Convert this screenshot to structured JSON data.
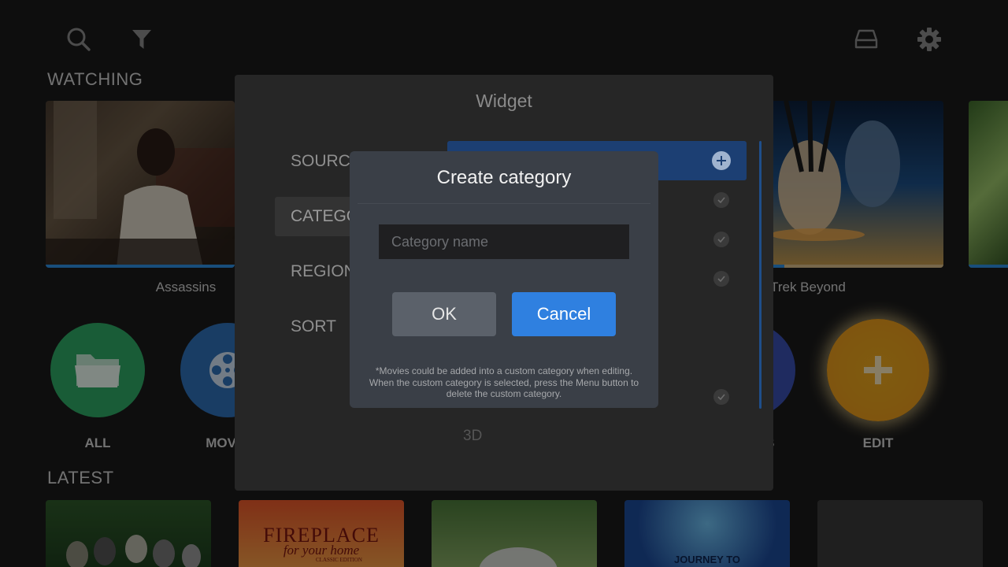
{
  "toolbar": {
    "left_icons": [
      "search-icon",
      "filter-icon"
    ],
    "right_icons": [
      "storage-icon",
      "gear-icon"
    ]
  },
  "watching": {
    "title": "WATCHING",
    "items": [
      {
        "title": "Assassins",
        "progress": 1.0
      },
      {
        "title": "Star Trek Beyond",
        "visible_title": "r Trek Beyond",
        "progress": 0.16
      }
    ]
  },
  "categories": {
    "items": [
      {
        "label": "ALL",
        "icon": "folder-icon",
        "color": "#2fa865"
      },
      {
        "label": "MOV",
        "icon": "film-reel-icon",
        "color": "#2f6fb6"
      },
      {
        "label": "S",
        "icon": "",
        "color": "#3a4fb0"
      },
      {
        "label": "EDIT",
        "icon": "plus-icon",
        "color": "#e7a521"
      }
    ]
  },
  "latest": {
    "title": "LATEST",
    "tiles": [
      {
        "text": ""
      },
      {
        "text": "FIREPLACE",
        "sub": "for your home",
        "sub2": "CLASSIC EDITION"
      },
      {
        "text": ""
      },
      {
        "text": "JOURNEY TO"
      },
      {
        "text": ""
      }
    ]
  },
  "widget": {
    "title": "Widget",
    "tabs": [
      {
        "label": "SOURCE",
        "visible": "SOURCE"
      },
      {
        "label": "CATEGORY",
        "visible": "CATEGO"
      },
      {
        "label": "REGION",
        "visible": "REGION"
      },
      {
        "label": "SORT",
        "visible": "SORT"
      }
    ],
    "row_3d": "3D"
  },
  "dialog": {
    "title": "Create category",
    "input_placeholder": "Category name",
    "input_value": "",
    "ok_label": "OK",
    "cancel_label": "Cancel",
    "note": "*Movies could be added into a custom category when editing. When the custom category is selected, press the Menu button to delete the custom category."
  },
  "colors": {
    "accent": "#2f80e0",
    "dialog_bg": "#3a3f47",
    "background": "#1b1b1b"
  }
}
